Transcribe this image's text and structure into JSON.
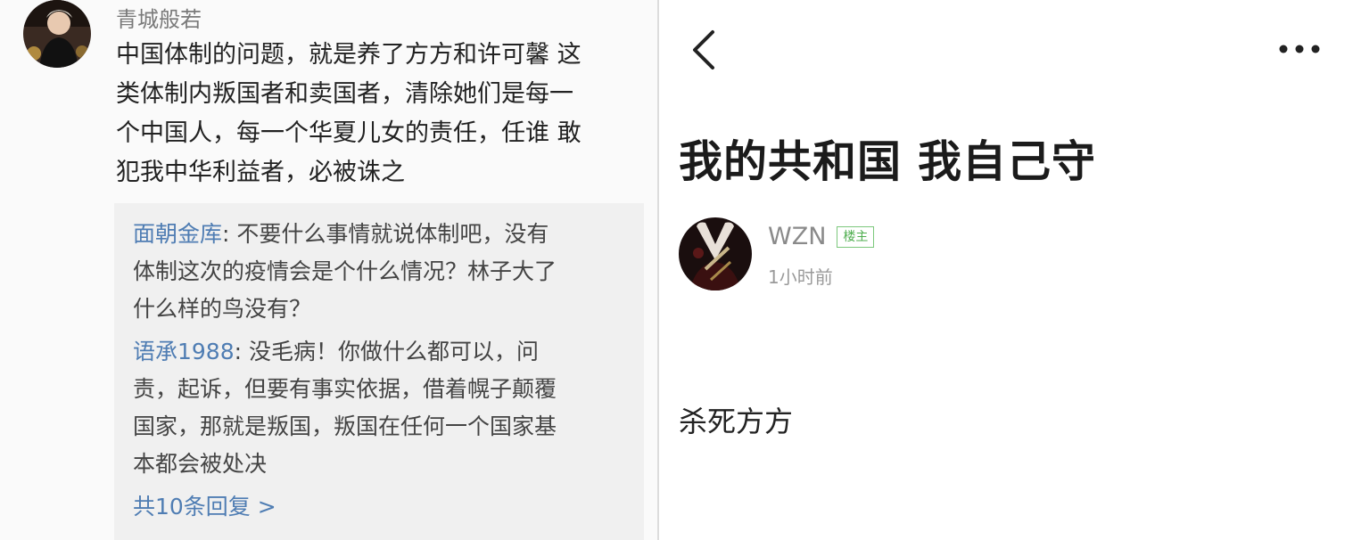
{
  "left_panel": {
    "commenter": "青城般若",
    "comment_lines": [
      "中国体制的问题，就是养了方方和许可馨 这",
      "类体制内叛国者和卖国者，清除她们是每一",
      "个中国人，每一个华夏儿女的责任，任谁 敢",
      "犯我中华利益者，必被诛之"
    ],
    "replies": [
      {
        "author": "面朝金库",
        "lines": [
          ": 不要什么事情就说体制吧，没有",
          "体制这次的疫情会是个什么情况？林子大了",
          "什么样的鸟没有？"
        ]
      },
      {
        "author": "语承1988",
        "lines": [
          ": 没毛病！你做什么都可以，问",
          "责，起诉，但要有事实依据，借着幌子颠覆",
          "国家，那就是叛国，叛国在任何一个国家基",
          "本都会被处决"
        ]
      }
    ],
    "more_replies": "共10条回复 >",
    "colors": {
      "link": "#4f7db3",
      "reply_bg": "#f0f0f0"
    }
  },
  "right_panel": {
    "back_icon": "chevron-left-icon",
    "more_icon": "more-dots-icon",
    "post_title": "我的共和国 我自己守",
    "author": "WZN",
    "owner_badge": "楼主",
    "time": "1小时前",
    "body": "杀死方方",
    "colors": {
      "badge": "#4fae4f"
    }
  }
}
